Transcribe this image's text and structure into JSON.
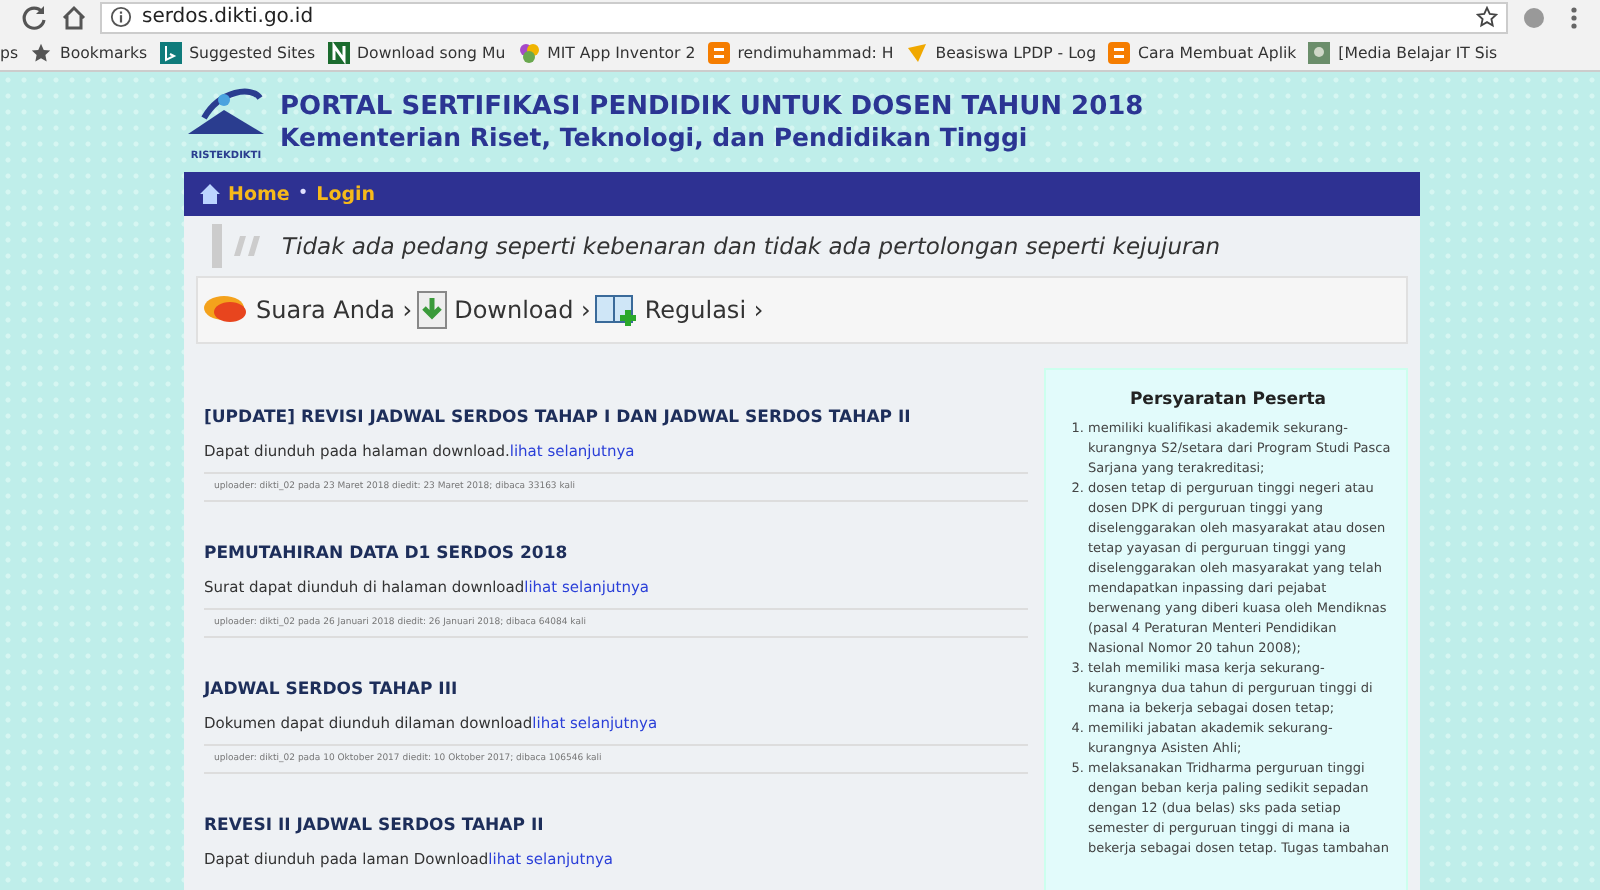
{
  "browser": {
    "url": "serdos.dikti.go.id",
    "bookmarks": [
      {
        "label": "ps",
        "kind": "none"
      },
      {
        "label": "Bookmarks",
        "kind": "star"
      },
      {
        "label": "Suggested Sites",
        "kind": "bing"
      },
      {
        "label": "Download song Mu",
        "kind": "n"
      },
      {
        "label": "MIT App Inventor 2",
        "kind": "mit"
      },
      {
        "label": "rendimuhammad: H",
        "kind": "blogger"
      },
      {
        "label": "Beasiswa LPDP - Log",
        "kind": "lpdp"
      },
      {
        "label": "Cara Membuat Aplik",
        "kind": "blogger"
      },
      {
        "label": "[Media Belajar IT Sis",
        "kind": "photo"
      }
    ]
  },
  "header": {
    "logo_text": "RISTEKDIKTI",
    "title": "PORTAL SERTIFIKASI PENDIDIK UNTUK DOSEN TAHUN 2018",
    "subtitle": "Kementerian Riset, Teknologi, dan Pendidikan Tinggi"
  },
  "nav": [
    {
      "label": "Home",
      "kind": "link"
    },
    {
      "label": "•",
      "kind": "separator"
    },
    {
      "label": "Login",
      "kind": "link"
    }
  ],
  "quote": "Tidak ada pedang seperti kebenaran dan tidak ada pertolongan seperti kejujuran",
  "quick_links": [
    {
      "label": "Suara Anda ›",
      "kind": "speech"
    },
    {
      "label": "Download ›",
      "kind": "download"
    },
    {
      "label": "Regulasi ›",
      "kind": "book"
    }
  ],
  "articles": [
    {
      "title": "[UPDATE] REVISI JADWAL SERDOS TAHAP I DAN JADWAL SERDOS TAHAP II",
      "summary": "Dapat diunduh pada halaman download.",
      "link": "lihat selanjutnya",
      "meta": "uploader: dikti_02 pada 23 Maret 2018 diedit: 23 Maret 2018; dibaca 33163 kali"
    },
    {
      "title": "PEMUTAHIRAN DATA D1 SERDOS 2018",
      "summary": "Surat dapat diunduh di halaman download",
      "link": "lihat selanjutnya",
      "meta": "uploader: dikti_02 pada 26 Januari 2018 diedit: 26 Januari 2018; dibaca 64084 kali"
    },
    {
      "title": "JADWAL SERDOS TAHAP III",
      "summary": "Dokumen dapat diunduh dilaman download",
      "link": "lihat selanjutnya",
      "meta": "uploader: dikti_02 pada 10 Oktober 2017 diedit: 10 Oktober 2017; dibaca 106546 kali"
    },
    {
      "title": "REVESI II JADWAL SERDOS TAHAP II",
      "summary": "Dapat diunduh pada laman Download",
      "link": "lihat selanjutnya"
    }
  ],
  "sidebar": {
    "title": "Persyaratan Peserta",
    "items": [
      {
        "number": "1.",
        "text": "memiliki kualifikasi akademik sekurang-kurangnya S2/setara dari Program Studi Pasca Sarjana yang terakreditasi;"
      },
      {
        "number": "2.",
        "text": "dosen tetap di perguruan tinggi negeri atau dosen DPK di perguruan tinggi yang diselenggarakan oleh masyarakat atau dosen tetap yayasan di perguruan tinggi yang diselenggarakan oleh masyarakat yang telah mendapatkan inpassing dari pejabat berwenang yang diberi kuasa oleh Mendiknas (pasal 4 Peraturan Menteri Pendidikan Nasional Nomor 20 tahun 2008);"
      },
      {
        "number": "3.",
        "text": "telah memiliki masa kerja sekurang-kurangnya dua tahun di perguruan tinggi di mana ia bekerja sebagai dosen tetap;"
      },
      {
        "number": "4.",
        "text": "memiliki jabatan akademik sekurang-kurangnya Asisten Ahli;"
      },
      {
        "number": "5.",
        "text": "melaksanakan Tridharma perguruan tinggi dengan beban kerja paling sedikit sepadan dengan 12 (dua belas) sks pada setiap semester di perguruan tinggi di mana ia bekerja sebagai dosen tetap. Tugas tambahan"
      }
    ]
  }
}
